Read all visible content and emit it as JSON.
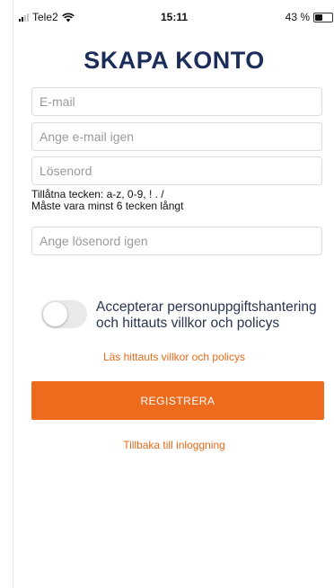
{
  "status_bar": {
    "carrier": "Tele2",
    "time": "15:11",
    "battery_percent": "43 %",
    "battery_level": 0.43
  },
  "page": {
    "title": "SKAPA KONTO"
  },
  "form": {
    "email_placeholder": "E-mail",
    "email_confirm_placeholder": "Ange e-mail igen",
    "password_placeholder": "Lösenord",
    "password_hint_line1": "Tillåtna tecken: a-z, 0-9, ! . /",
    "password_hint_line2": "Måste vara minst 6 tecken långt",
    "password_confirm_placeholder": "Ange lösenord igen",
    "consent_text": "Accepterar personuppgiftshantering och hittauts villkor och policys",
    "consent_checked": false,
    "terms_link": "Läs hittauts villkor och policys",
    "register_button": "REGISTRERA",
    "back_link": "Tillbaka till inloggning"
  },
  "colors": {
    "accent": "#ee6a1c",
    "title": "#1d2d5a"
  }
}
